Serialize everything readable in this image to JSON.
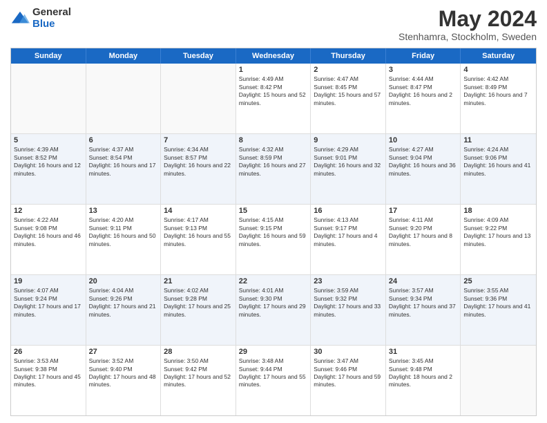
{
  "logo": {
    "general": "General",
    "blue": "Blue"
  },
  "title": "May 2024",
  "location": "Stenhamra, Stockholm, Sweden",
  "days_of_week": [
    "Sunday",
    "Monday",
    "Tuesday",
    "Wednesday",
    "Thursday",
    "Friday",
    "Saturday"
  ],
  "weeks": [
    [
      {
        "day": "",
        "empty": true
      },
      {
        "day": "",
        "empty": true
      },
      {
        "day": "",
        "empty": true
      },
      {
        "day": "1",
        "sunrise": "4:49 AM",
        "sunset": "8:42 PM",
        "daylight": "15 hours and 52 minutes."
      },
      {
        "day": "2",
        "sunrise": "4:47 AM",
        "sunset": "8:45 PM",
        "daylight": "15 hours and 57 minutes."
      },
      {
        "day": "3",
        "sunrise": "4:44 AM",
        "sunset": "8:47 PM",
        "daylight": "16 hours and 2 minutes."
      },
      {
        "day": "4",
        "sunrise": "4:42 AM",
        "sunset": "8:49 PM",
        "daylight": "16 hours and 7 minutes."
      }
    ],
    [
      {
        "day": "5",
        "sunrise": "4:39 AM",
        "sunset": "8:52 PM",
        "daylight": "16 hours and 12 minutes."
      },
      {
        "day": "6",
        "sunrise": "4:37 AM",
        "sunset": "8:54 PM",
        "daylight": "16 hours and 17 minutes."
      },
      {
        "day": "7",
        "sunrise": "4:34 AM",
        "sunset": "8:57 PM",
        "daylight": "16 hours and 22 minutes."
      },
      {
        "day": "8",
        "sunrise": "4:32 AM",
        "sunset": "8:59 PM",
        "daylight": "16 hours and 27 minutes."
      },
      {
        "day": "9",
        "sunrise": "4:29 AM",
        "sunset": "9:01 PM",
        "daylight": "16 hours and 32 minutes."
      },
      {
        "day": "10",
        "sunrise": "4:27 AM",
        "sunset": "9:04 PM",
        "daylight": "16 hours and 36 minutes."
      },
      {
        "day": "11",
        "sunrise": "4:24 AM",
        "sunset": "9:06 PM",
        "daylight": "16 hours and 41 minutes."
      }
    ],
    [
      {
        "day": "12",
        "sunrise": "4:22 AM",
        "sunset": "9:08 PM",
        "daylight": "16 hours and 46 minutes."
      },
      {
        "day": "13",
        "sunrise": "4:20 AM",
        "sunset": "9:11 PM",
        "daylight": "16 hours and 50 minutes."
      },
      {
        "day": "14",
        "sunrise": "4:17 AM",
        "sunset": "9:13 PM",
        "daylight": "16 hours and 55 minutes."
      },
      {
        "day": "15",
        "sunrise": "4:15 AM",
        "sunset": "9:15 PM",
        "daylight": "16 hours and 59 minutes."
      },
      {
        "day": "16",
        "sunrise": "4:13 AM",
        "sunset": "9:17 PM",
        "daylight": "17 hours and 4 minutes."
      },
      {
        "day": "17",
        "sunrise": "4:11 AM",
        "sunset": "9:20 PM",
        "daylight": "17 hours and 8 minutes."
      },
      {
        "day": "18",
        "sunrise": "4:09 AM",
        "sunset": "9:22 PM",
        "daylight": "17 hours and 13 minutes."
      }
    ],
    [
      {
        "day": "19",
        "sunrise": "4:07 AM",
        "sunset": "9:24 PM",
        "daylight": "17 hours and 17 minutes."
      },
      {
        "day": "20",
        "sunrise": "4:04 AM",
        "sunset": "9:26 PM",
        "daylight": "17 hours and 21 minutes."
      },
      {
        "day": "21",
        "sunrise": "4:02 AM",
        "sunset": "9:28 PM",
        "daylight": "17 hours and 25 minutes."
      },
      {
        "day": "22",
        "sunrise": "4:01 AM",
        "sunset": "9:30 PM",
        "daylight": "17 hours and 29 minutes."
      },
      {
        "day": "23",
        "sunrise": "3:59 AM",
        "sunset": "9:32 PM",
        "daylight": "17 hours and 33 minutes."
      },
      {
        "day": "24",
        "sunrise": "3:57 AM",
        "sunset": "9:34 PM",
        "daylight": "17 hours and 37 minutes."
      },
      {
        "day": "25",
        "sunrise": "3:55 AM",
        "sunset": "9:36 PM",
        "daylight": "17 hours and 41 minutes."
      }
    ],
    [
      {
        "day": "26",
        "sunrise": "3:53 AM",
        "sunset": "9:38 PM",
        "daylight": "17 hours and 45 minutes."
      },
      {
        "day": "27",
        "sunrise": "3:52 AM",
        "sunset": "9:40 PM",
        "daylight": "17 hours and 48 minutes."
      },
      {
        "day": "28",
        "sunrise": "3:50 AM",
        "sunset": "9:42 PM",
        "daylight": "17 hours and 52 minutes."
      },
      {
        "day": "29",
        "sunrise": "3:48 AM",
        "sunset": "9:44 PM",
        "daylight": "17 hours and 55 minutes."
      },
      {
        "day": "30",
        "sunrise": "3:47 AM",
        "sunset": "9:46 PM",
        "daylight": "17 hours and 59 minutes."
      },
      {
        "day": "31",
        "sunrise": "3:45 AM",
        "sunset": "9:48 PM",
        "daylight": "18 hours and 2 minutes."
      },
      {
        "day": "",
        "empty": true
      }
    ]
  ]
}
